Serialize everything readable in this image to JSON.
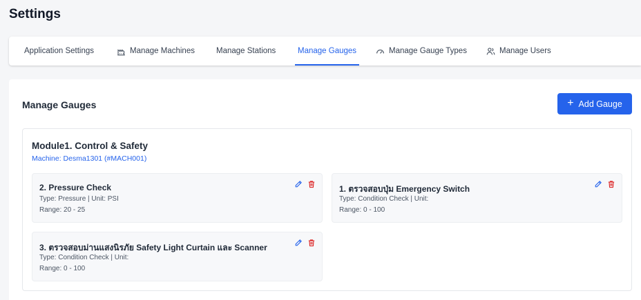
{
  "page": {
    "title": "Settings"
  },
  "tabs": [
    {
      "label": "Application Settings",
      "icon": "none"
    },
    {
      "label": "Manage Machines",
      "icon": "factory-icon"
    },
    {
      "label": "Manage Stations",
      "icon": "none"
    },
    {
      "label": "Manage Gauges",
      "icon": "none",
      "active": true
    },
    {
      "label": "Manage Gauge Types",
      "icon": "gauge-icon"
    },
    {
      "label": "Manage Users",
      "icon": "users-icon"
    }
  ],
  "section": {
    "title": "Manage Gauges",
    "add_button_label": "Add Gauge"
  },
  "module": {
    "title": "Module1. Control & Safety",
    "machine": "Machine: Desma1301 (#MACH001)",
    "gauges": [
      {
        "name": "2. Pressure Check",
        "type_line": "Type: Pressure | Unit: PSI",
        "range_line": "Range: 20 - 25"
      },
      {
        "name": "1. ตรวจสอบปุ่ม Emergency Switch",
        "type_line": "Type: Condition Check | Unit:",
        "range_line": "Range: 0 - 100"
      },
      {
        "name": "3. ตรวจสอบม่านแสงนิรภัย Safety Light Curtain และ Scanner",
        "type_line": "Type: Condition Check | Unit:",
        "range_line": "Range: 0 - 100"
      }
    ]
  },
  "colors": {
    "accent": "#2563eb",
    "delete": "#dc2626",
    "background": "#f5f6f8"
  }
}
